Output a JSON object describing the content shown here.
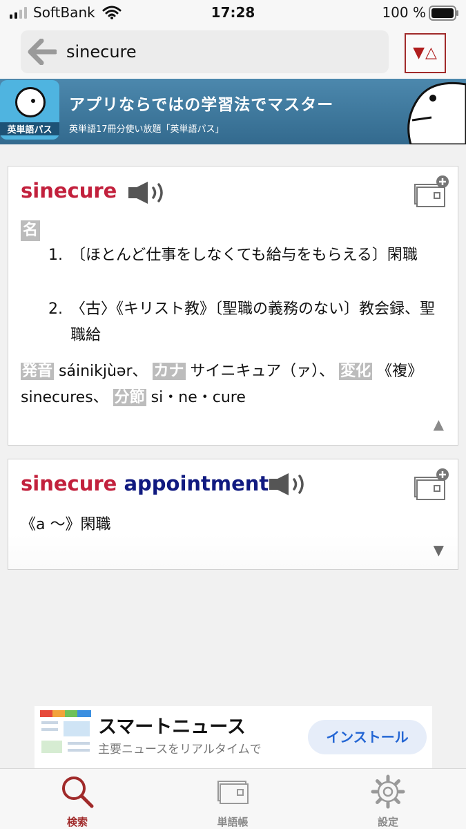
{
  "status_bar": {
    "carrier": "SoftBank",
    "time": "17:28",
    "battery": "100 %"
  },
  "search": {
    "query": "sinecure",
    "sort_toggle_down": "▼",
    "sort_toggle_up": "△"
  },
  "banner": {
    "app_label": "英単語パス",
    "title": "アプリならではの学習法でマスター",
    "subtitle": "英単語17冊分使い放題「英単語パス」"
  },
  "entry_1": {
    "headword": "sinecure",
    "pos": "名",
    "senses": [
      {
        "num": "1.",
        "text": "〔ほとんど仕事をしなくても給与をもらえる〕閑職"
      },
      {
        "num": "2.",
        "text": "〈古〉《キリスト教》〔聖職の義務のない〕教会録、聖職給"
      }
    ],
    "pronunciation_label": "発音",
    "pronunciation": "sáinikjùər、",
    "kana_label": "カナ",
    "kana": "サイニキュア（ァ）、",
    "inflection_label": "変化",
    "inflection": "《複》sinecures、",
    "syllable_label": "分節",
    "syllables": "si・ne・cure",
    "collapse_glyph": "▲"
  },
  "entry_2": {
    "headword_first": "sinecure",
    "headword_rest": "appointment",
    "meaning": "《a ～》閑職",
    "expand_glyph": "▼"
  },
  "bottom_ad": {
    "title": "スマートニュース",
    "subtitle": "主要ニュースをリアルタイムで",
    "install_label": "インストール"
  },
  "tab_bar": {
    "tabs": [
      {
        "label": "検索",
        "icon": "search-icon"
      },
      {
        "label": "単語帳",
        "icon": "wordbook-icon"
      },
      {
        "label": "設定",
        "icon": "gear-icon"
      }
    ]
  },
  "colors": {
    "headword": "#c2203c",
    "phrase_rest": "#101a80",
    "active_tab": "#a02a2a",
    "banner": "#3e7aa0"
  }
}
